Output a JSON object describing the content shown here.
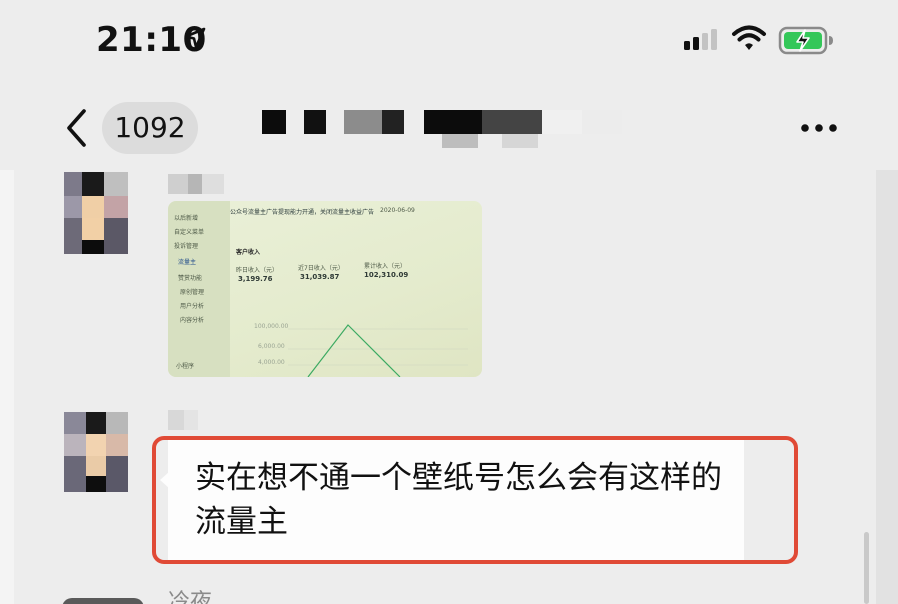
{
  "status_bar": {
    "time": "21:10",
    "icons": [
      "location-arrow-icon",
      "signal-icon",
      "wifi-icon",
      "battery-charging-icon"
    ]
  },
  "nav": {
    "back_icon": "chevron-left-icon",
    "unread_count": "1092",
    "more_icon": "ellipsis-icon"
  },
  "messages": [
    {
      "type": "image",
      "screenshot": {
        "header": "公众号流量主广告提现能力开通，关闭流量主收益广告",
        "date": "2020-06-09",
        "menu": [
          "以后新增",
          "自定义菜单",
          "投诉管理",
          "流量主",
          "赞赏功能",
          "原创管理",
          "用户分析",
          "内容分析"
        ],
        "section_title": "客户收入",
        "metrics": [
          {
            "label": "昨日收入（元）",
            "value": "3,199.76"
          },
          {
            "label": "近7日收入（元）",
            "value": "31,039.87"
          },
          {
            "label": "累计收入（元）",
            "value": "102,310.09"
          }
        ],
        "axis": [
          "100,000.00",
          "6,000.00",
          "4,000.00"
        ],
        "footer": "小程序"
      }
    },
    {
      "type": "text",
      "text": "实在想不通一个壁纸号怎么会有这样的流量主"
    }
  ],
  "next_sender": "冷夜",
  "colors": {
    "background": "#ededed",
    "bubble": "#fdfdfd",
    "highlight": "#e04a36",
    "battery": "#34c759"
  }
}
